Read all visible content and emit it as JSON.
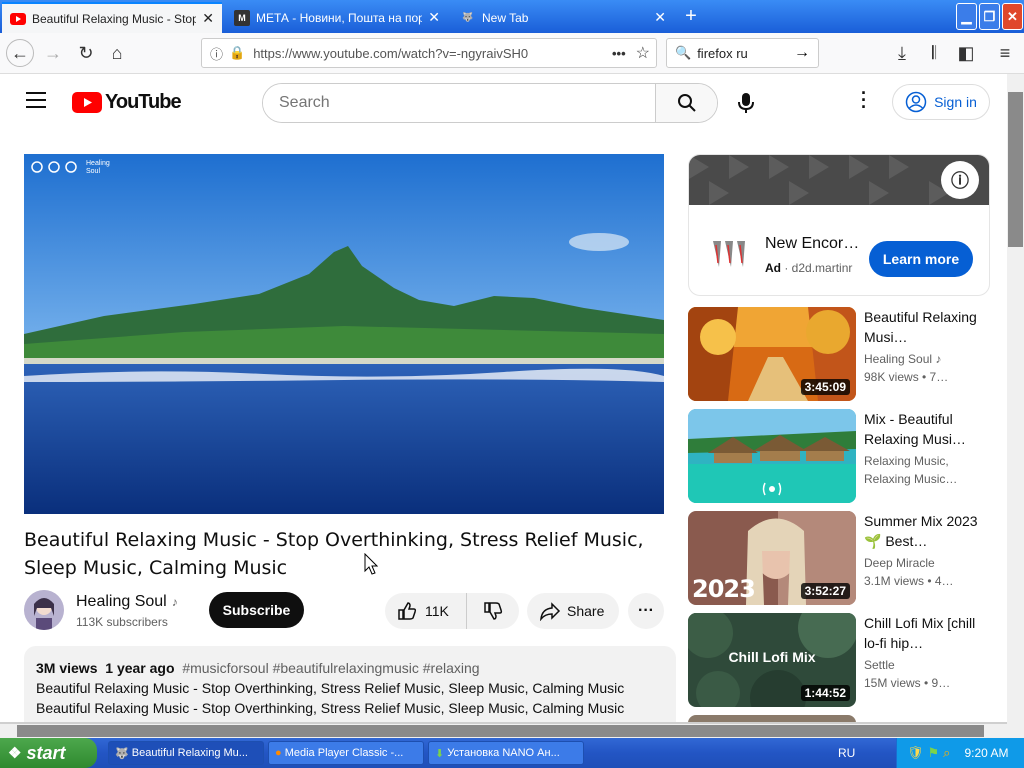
{
  "browser": {
    "tabs": [
      {
        "title": "Beautiful Relaxing Music - Stop Ov",
        "active": true
      },
      {
        "title": "МЕТА - Новини, Пошта на портал",
        "active": false
      },
      {
        "title": "New Tab",
        "active": false
      }
    ],
    "url": "https://www.youtube.com/watch?v=-ngyraivSH0",
    "search_value": "firefox ru"
  },
  "youtube": {
    "logo_text": "YouTube",
    "search_placeholder": "Search",
    "sign_in": "Sign in",
    "video": {
      "title": "Beautiful Relaxing Music - Stop Overthinking, Stress Relief Music, Sleep Music, Calming Music",
      "channel": "Healing Soul",
      "subscribers": "113K subscribers",
      "subscribe": "Subscribe",
      "likes": "11K",
      "share": "Share",
      "overlay_label": "Healing Soul",
      "views": "3M views",
      "age": "1 year ago",
      "hashtags": "#musicforsoul #beautifulrelaxingmusic #relaxing",
      "desc_line1": "Beautiful Relaxing Music - Stop Overthinking, Stress Relief Music, Sleep Music, Calming Music",
      "desc_line2": "Beautiful Relaxing Music - Stop Overthinking, Stress Relief Music, Sleep Music, Calming Music"
    },
    "ad": {
      "title": "New Encor…",
      "badge": "Ad",
      "domain": "d2d.martinr",
      "cta": "Learn more"
    },
    "related": [
      {
        "title": "Beautiful Relaxing Musi…",
        "channel": "Healing Soul",
        "meta": "98K views • 7…",
        "duration": "3:45:09"
      },
      {
        "title": "Mix - Beautiful Relaxing Musi…",
        "channel": "Relaxing Music,",
        "meta": "Relaxing Music…",
        "duration": ""
      },
      {
        "title": "Summer Mix 2023🌱 Best…",
        "channel": "Deep Miracle",
        "meta": "3.1M views • 4…",
        "duration": "3:52:27",
        "overlay": "2023"
      },
      {
        "title": "Chill Lofi Mix [chill lo-fi hip…",
        "channel": "Settle",
        "meta": "15M views • 9…",
        "duration": "1:44:52",
        "overlay": "Chill Lofi Mix"
      }
    ]
  },
  "taskbar": {
    "start": "start",
    "tasks": [
      "Beautiful Relaxing Mu...",
      "Media Player Classic -...",
      "Установка NANO Ан..."
    ],
    "lang": "RU",
    "time": "9:20 AM"
  },
  "colors": {
    "yt_red": "#ff0000",
    "link_blue": "#065fd4",
    "subscribe_bg": "#0f0f0f"
  }
}
